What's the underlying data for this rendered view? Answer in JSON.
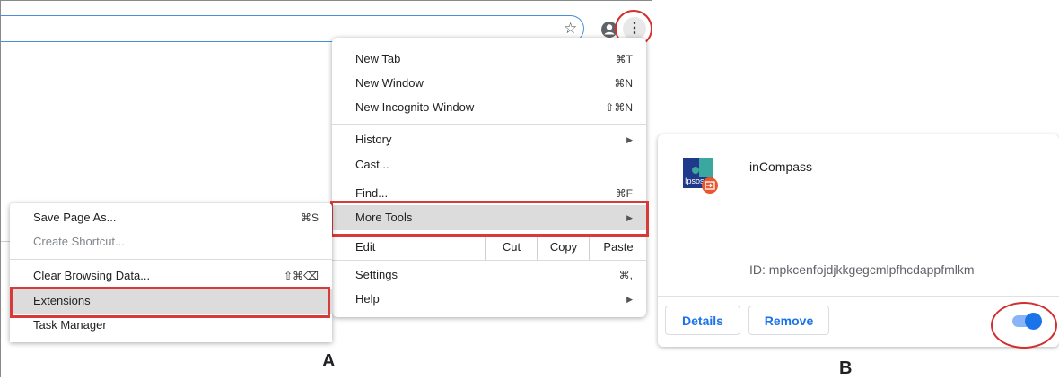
{
  "chrome_menu": {
    "items": [
      {
        "label": "New Tab",
        "shortcut": "⌘T"
      },
      {
        "label": "New Window",
        "shortcut": "⌘N"
      },
      {
        "label": "New Incognito Window",
        "shortcut": "⇧⌘N"
      },
      {
        "label": "History",
        "shortcut": ""
      },
      {
        "label": "Cast...",
        "shortcut": ""
      },
      {
        "label": "Find...",
        "shortcut": "⌘F"
      },
      {
        "label": "More Tools",
        "shortcut": ""
      },
      {
        "label": "Edit",
        "shortcut": ""
      },
      {
        "label": "Settings",
        "shortcut": "⌘,"
      },
      {
        "label": "Help",
        "shortcut": ""
      }
    ],
    "edit_actions": [
      "Cut",
      "Copy",
      "Paste"
    ]
  },
  "more_tools_menu": {
    "items": [
      {
        "label": "Save Page As...",
        "shortcut": "⌘S"
      },
      {
        "label": "Create Shortcut...",
        "shortcut": ""
      },
      {
        "label": "Clear Browsing Data...",
        "shortcut": "⇧⌘⌫"
      },
      {
        "label": "Extensions",
        "shortcut": ""
      },
      {
        "label": "Task Manager",
        "shortcut": ""
      }
    ]
  },
  "panel_labels": {
    "a": "A",
    "b": "B"
  },
  "extension_card": {
    "name": "inCompass",
    "logo_text": "Ipsos",
    "id_text": "ID: mpkcenfojdjkkgegcmlpfhcdappfmlkm",
    "details_label": "Details",
    "remove_label": "Remove",
    "enabled": true
  },
  "colors": {
    "highlight_red": "#d83a3a",
    "accent_blue": "#1a73e8",
    "logo_teal": "#3aa89e",
    "logo_navy": "#1f3a8a",
    "badge_orange": "#e8572e"
  }
}
